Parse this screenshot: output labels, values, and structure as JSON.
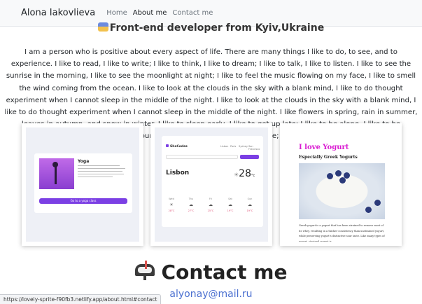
{
  "nav": {
    "brand": "Alona Iakovlieva",
    "links": [
      "Home",
      "About me",
      "Contact me"
    ]
  },
  "about": {
    "headline": "Front-end developer from Kyiv,Ukraine",
    "paragraph": "I am a person who is positive about every aspect of life. There are many things I like to do, to see, and to experience. I like to read, I like to write; I like to think, I like to dream; I like to talk, I like to listen. I like to see the sunrise in the morning, I like to see the moonlight at night; I like to feel the music flowing on my face, I like to smell the wind coming from the ocean. I like to look at the clouds in the sky with a blank mind, I like to do thought experiment when I cannot sleep in the middle of the night. I like to look at the clouds in the sky with a blank mind, I like to do thought experiment when I cannot sleep in the middle of the night. I like flowers in spring, rain in summer, leaves in autumn, and snow in winter. I like to sleep early, I like to get up late; I like to be alone, I like to be surrounded by people. I like country's peace, I like metropolis' noise; I like the land and the nature."
  },
  "projects": {
    "yoga": {
      "title": "Yoga",
      "button": "Go to a yoga class"
    },
    "weather": {
      "logo": "SheCodes",
      "nav": [
        "Lisbon",
        "Paris",
        "Sydney",
        "San Francisco"
      ],
      "city": "Lisbon",
      "temperature": "28",
      "unit": "°c",
      "days": [
        {
          "day": "Wed",
          "icon": "☀",
          "temp": "28°C"
        },
        {
          "day": "Thu",
          "icon": "☁",
          "temp": "27°C"
        },
        {
          "day": "Fri",
          "icon": "☁",
          "temp": "25°C"
        },
        {
          "day": "Sat",
          "icon": "☁",
          "temp": "19°C"
        },
        {
          "day": "Sun",
          "icon": "☁",
          "temp": "19°C"
        }
      ]
    },
    "yogurt": {
      "title": "I love Yogurt",
      "subtitle": "Especially Greek Yogurts",
      "text": "Greek yogurt is a yogurt that has been strained to remove most of its whey, resulting in a thicker consistency than unstrained yogurt, while preserving yogurt's distinctive sour taste. Like many types of yogurt, strained yogurt is"
    }
  },
  "contact": {
    "heading": "Contact me",
    "email": "alyonay@mail.ru"
  },
  "status_url": "https://lovely-sprite-f90fb3.netlify.app/about.html#contact",
  "colors": {
    "accent": "#7b3fe4",
    "yogurt_title": "#d91ad1",
    "email": "#4a6fd0"
  }
}
